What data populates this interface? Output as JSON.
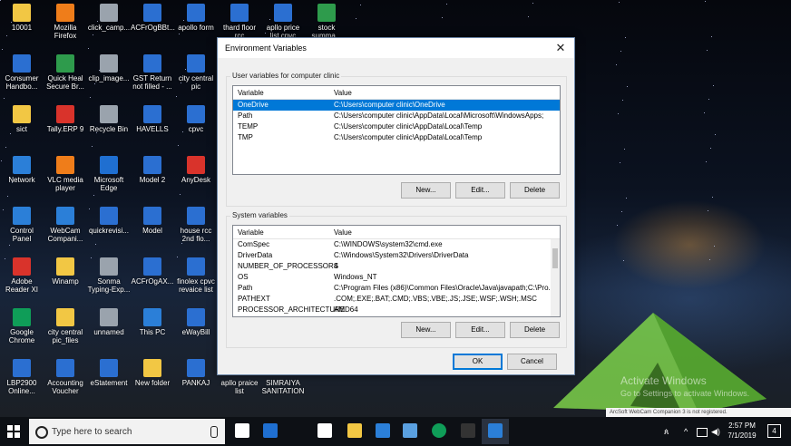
{
  "desktop_icons": [
    {
      "label": "10001",
      "icon": "folder-icon",
      "color": "#f2c744"
    },
    {
      "label": "Mozilla Firefox",
      "icon": "firefox-icon",
      "color": "#ef7d1a"
    },
    {
      "label": "click_camp...",
      "icon": "shortcut-icon",
      "color": "#9aa3ad"
    },
    {
      "label": "ACFrOgBBt...",
      "icon": "pdf-icon",
      "color": "#2b6fd1"
    },
    {
      "label": "apollo form",
      "icon": "pdf-icon",
      "color": "#2b6fd1"
    },
    {
      "label": "thard floor rcc",
      "icon": "pdf-icon",
      "color": "#2b6fd1"
    },
    {
      "label": "apllo price list cpvc",
      "icon": "pdf-icon",
      "color": "#2b6fd1"
    },
    {
      "label": "stock summa...",
      "icon": "spreadsheet-icon",
      "color": "#2e9b4c"
    },
    {
      "label": "Consumer Handbo...",
      "icon": "pdf-icon",
      "color": "#2b6fd1"
    },
    {
      "label": "Quick Heal Secure Br...",
      "icon": "quickheal-icon",
      "color": "#2e9b4c"
    },
    {
      "label": "clip_image...",
      "icon": "image-icon",
      "color": "#9aa3ad"
    },
    {
      "label": "GST Return not filled - ...",
      "icon": "pdf-icon",
      "color": "#2b6fd1"
    },
    {
      "label": "city central pic",
      "icon": "edge-doc-icon",
      "color": "#2b6fd1"
    },
    {
      "label": "sict",
      "icon": "folder-icon",
      "color": "#f2c744"
    },
    {
      "label": "Tally.ERP 9",
      "icon": "tally-icon",
      "color": "#d9332b"
    },
    {
      "label": "Recycle Bin",
      "icon": "recycle-bin-icon",
      "color": "#9aa3ad"
    },
    {
      "label": "HAVELLS",
      "icon": "pdf-icon",
      "color": "#2b6fd1"
    },
    {
      "label": "cpvc",
      "icon": "pdf-icon",
      "color": "#2b6fd1"
    },
    {
      "label": "Network",
      "icon": "network-icon",
      "color": "#2b7fd8"
    },
    {
      "label": "VLC media player",
      "icon": "vlc-icon",
      "color": "#ef7d1a"
    },
    {
      "label": "Microsoft Edge",
      "icon": "edge-icon",
      "color": "#1f6fd1"
    },
    {
      "label": "Model 2",
      "icon": "pdf-icon",
      "color": "#2b6fd1"
    },
    {
      "label": "AnyDesk",
      "icon": "anydesk-icon",
      "color": "#d9332b"
    },
    {
      "label": "Control Panel",
      "icon": "control-panel-icon",
      "color": "#2b7fd8"
    },
    {
      "label": "WebCam Compani...",
      "icon": "webcam-icon",
      "color": "#2b7fd8"
    },
    {
      "label": "quickrevisi...",
      "icon": "pdf-icon",
      "color": "#2b6fd1"
    },
    {
      "label": "Model",
      "icon": "pdf-icon",
      "color": "#2b6fd1"
    },
    {
      "label": "house rcc 2nd flo...",
      "icon": "pdf-icon",
      "color": "#2b6fd1"
    },
    {
      "label": "Adobe Reader XI",
      "icon": "adobe-reader-icon",
      "color": "#d9332b"
    },
    {
      "label": "Winamp",
      "icon": "winamp-icon",
      "color": "#f2c744"
    },
    {
      "label": "Sonma Typing-Exp...",
      "icon": "sonma-icon",
      "color": "#9aa3ad"
    },
    {
      "label": "ACFrOgAX...",
      "icon": "pdf-icon",
      "color": "#2b6fd1"
    },
    {
      "label": "finolex cpvc revaice list",
      "icon": "pdf-icon",
      "color": "#2b6fd1"
    },
    {
      "label": "Google Chrome",
      "icon": "chrome-icon",
      "color": "#0f9d58"
    },
    {
      "label": "city central pic_files",
      "icon": "folder-icon",
      "color": "#f2c744"
    },
    {
      "label": "unnamed",
      "icon": "image-icon",
      "color": "#9aa3ad"
    },
    {
      "label": "This PC",
      "icon": "this-pc-icon",
      "color": "#2b7fd8"
    },
    {
      "label": "eWayBill",
      "icon": "pdf-icon",
      "color": "#2b6fd1"
    },
    {
      "label": "LBP2900 Online...",
      "icon": "pdf-icon",
      "color": "#2b6fd1"
    },
    {
      "label": "Accounting Voucher",
      "icon": "pdf-icon",
      "color": "#2b6fd1"
    },
    {
      "label": "eStatement",
      "icon": "pdf-icon",
      "color": "#2b6fd1"
    },
    {
      "label": "New folder",
      "icon": "folder-icon",
      "color": "#f2c744"
    },
    {
      "label": "PANKAJ",
      "icon": "pdf-icon",
      "color": "#2b6fd1"
    },
    {
      "label": "apllo praice list",
      "icon": "blank-icon",
      "color": "#0b1220"
    },
    {
      "label": "SIMRAIYA SANITATION",
      "icon": "blank-icon",
      "color": "#0b1220"
    }
  ],
  "dialog": {
    "title": "Environment Variables",
    "close_glyph": "✕",
    "user_group_label": "User variables for computer clinic",
    "user_headers": {
      "variable": "Variable",
      "value": "Value"
    },
    "user_vars": [
      {
        "name": "OneDrive",
        "value": "C:\\Users\\computer clinic\\OneDrive",
        "selected": true
      },
      {
        "name": "Path",
        "value": "C:\\Users\\computer clinic\\AppData\\Local\\Microsoft\\WindowsApps;"
      },
      {
        "name": "TEMP",
        "value": "C:\\Users\\computer clinic\\AppData\\Local\\Temp"
      },
      {
        "name": "TMP",
        "value": "C:\\Users\\computer clinic\\AppData\\Local\\Temp"
      }
    ],
    "user_buttons": {
      "new": "New...",
      "edit": "Edit...",
      "delete": "Delete"
    },
    "system_group_label": "System variables",
    "system_headers": {
      "variable": "Variable",
      "value": "Value"
    },
    "system_vars": [
      {
        "name": "ComSpec",
        "value": "C:\\WINDOWS\\system32\\cmd.exe"
      },
      {
        "name": "DriverData",
        "value": "C:\\Windows\\System32\\Drivers\\DriverData"
      },
      {
        "name": "NUMBER_OF_PROCESSORS",
        "value": "4"
      },
      {
        "name": "OS",
        "value": "Windows_NT"
      },
      {
        "name": "Path",
        "value": "C:\\Program Files (x86)\\Common Files\\Oracle\\Java\\javapath;C:\\Pro..."
      },
      {
        "name": "PATHEXT",
        "value": ".COM;.EXE;.BAT;.CMD;.VBS;.VBE;.JS;.JSE;.WSF;.WSH;.MSC"
      },
      {
        "name": "PROCESSOR_ARCHITECTURE",
        "value": "AMD64"
      }
    ],
    "system_buttons": {
      "new": "New...",
      "edit": "Edit...",
      "delete": "Delete"
    },
    "ok": "OK",
    "cancel": "Cancel"
  },
  "watermark": {
    "line1": "Activate Windows",
    "line2": "Go to Settings to activate Windows."
  },
  "arcsoft_banner": "ArcSoft WebCam Companion 3 is not registered.",
  "taskbar": {
    "search_placeholder": "Type here to search",
    "pinned": [
      {
        "icon": "task-view-icon",
        "color": "#ffffff"
      },
      {
        "icon": "edge-icon",
        "color": "#1f6fd1"
      },
      {
        "icon": "store-icon",
        "color": "#ffffff"
      },
      {
        "icon": "file-explorer-icon",
        "color": "#f2c744"
      },
      {
        "icon": "app-icon",
        "color": "#2b7fd8"
      },
      {
        "icon": "app-icon",
        "color": "#5aa0e0"
      },
      {
        "icon": "chrome-icon",
        "color": "#0f9d58"
      },
      {
        "icon": "cmd-icon",
        "color": "#333333"
      },
      {
        "icon": "system-properties-icon",
        "color": "#2b7fd8"
      }
    ],
    "tray_text": "ጰ",
    "time": "2:57 PM",
    "date": "7/1/2019",
    "notifications": "4"
  }
}
